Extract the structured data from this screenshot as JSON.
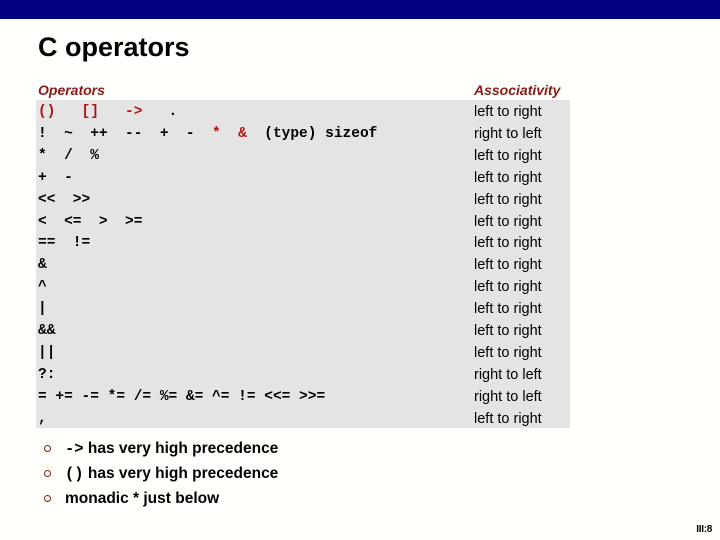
{
  "colors": {
    "top_bar": "#000080",
    "accent_dark_red": "#8c1919",
    "operator_red": "#b01414",
    "table_background": "#e4e4e4",
    "page_background": "#fffffb",
    "text": "#000000"
  },
  "title": "C operators",
  "table": {
    "headers": {
      "operators": "Operators",
      "associativity": "Associativity"
    },
    "rows": [
      {
        "operators_text": "()   []   ->   .",
        "tokens": [
          {
            "text": "()",
            "color": "red"
          },
          {
            "text": "   ",
            "color": "black"
          },
          {
            "text": "[]",
            "color": "red"
          },
          {
            "text": "   ",
            "color": "black"
          },
          {
            "text": "->",
            "color": "red"
          },
          {
            "text": "   .",
            "color": "black"
          }
        ],
        "associativity": "left to right"
      },
      {
        "operators_text": "!  ~  ++  --  +  -  *  &  (type) sizeof",
        "tokens": [
          {
            "text": "!  ~  ++  --  +  -  ",
            "color": "black"
          },
          {
            "text": "*",
            "color": "red"
          },
          {
            "text": "  ",
            "color": "black"
          },
          {
            "text": "&",
            "color": "red"
          },
          {
            "text": "  (type) sizeof",
            "color": "black"
          }
        ],
        "associativity": "right to left"
      },
      {
        "operators_text": "*  /  %",
        "tokens": [
          {
            "text": "*  /  %",
            "color": "black"
          }
        ],
        "associativity": "left to right"
      },
      {
        "operators_text": "+  -",
        "tokens": [
          {
            "text": "+  -",
            "color": "black"
          }
        ],
        "associativity": "left to right"
      },
      {
        "operators_text": "<<  >>",
        "tokens": [
          {
            "text": "<<  >>",
            "color": "black"
          }
        ],
        "associativity": "left to right"
      },
      {
        "operators_text": "<  <=  >  >=",
        "tokens": [
          {
            "text": "<  <=  >  >=",
            "color": "black"
          }
        ],
        "associativity": "left to right"
      },
      {
        "operators_text": "==  !=",
        "tokens": [
          {
            "text": "==  !=",
            "color": "black"
          }
        ],
        "associativity": "left to right"
      },
      {
        "operators_text": "&",
        "tokens": [
          {
            "text": "&",
            "color": "black"
          }
        ],
        "associativity": "left to right"
      },
      {
        "operators_text": "^",
        "tokens": [
          {
            "text": "^",
            "color": "black"
          }
        ],
        "associativity": "left to right"
      },
      {
        "operators_text": "|",
        "tokens": [
          {
            "text": "|",
            "color": "black"
          }
        ],
        "associativity": "left to right"
      },
      {
        "operators_text": "&&",
        "tokens": [
          {
            "text": "&&",
            "color": "black"
          }
        ],
        "associativity": "left to right"
      },
      {
        "operators_text": "||",
        "tokens": [
          {
            "text": "||",
            "color": "black"
          }
        ],
        "associativity": "left to right"
      },
      {
        "operators_text": "?:",
        "tokens": [
          {
            "text": "?:",
            "color": "black"
          }
        ],
        "associativity": "right to left"
      },
      {
        "operators_text": "= += -= *= /= %= &= ^= != <<= >>=",
        "tokens": [
          {
            "text": "= += -= *= /= %= &= ^= != <<= >>=",
            "color": "black"
          }
        ],
        "associativity": "right to left"
      },
      {
        "operators_text": ",",
        "tokens": [
          {
            "text": ",",
            "color": "black"
          }
        ],
        "associativity": "left to right"
      }
    ]
  },
  "bullets": [
    {
      "code": "->",
      "rest": " has very high precedence"
    },
    {
      "code": "()",
      "rest": " has very high precedence"
    },
    {
      "code": "",
      "rest": "monadic * just below"
    }
  ],
  "page_number": "III:8"
}
